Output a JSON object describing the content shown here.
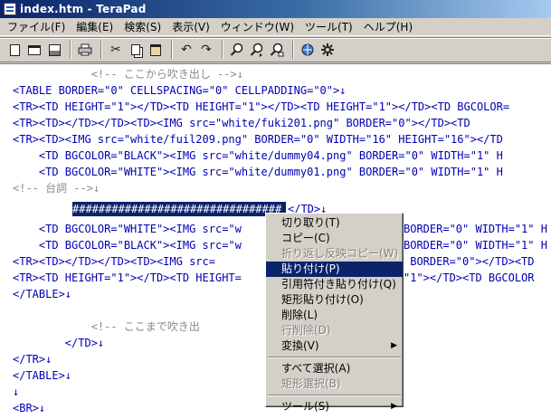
{
  "window": {
    "title": "index.htm - TeraPad"
  },
  "menubar": {
    "items": [
      {
        "label": "ファイル(F)"
      },
      {
        "label": "編集(E)"
      },
      {
        "label": "検索(S)"
      },
      {
        "label": "表示(V)"
      },
      {
        "label": "ウィンドウ(W)"
      },
      {
        "label": "ツール(T)"
      },
      {
        "label": "ヘルプ(H)"
      }
    ]
  },
  "toolbar": {
    "buttons": [
      {
        "icon": "new-file-icon"
      },
      {
        "icon": "open-file-icon"
      },
      {
        "icon": "save-icon"
      },
      {
        "icon": "print-icon"
      },
      {
        "icon": "cut-icon"
      },
      {
        "icon": "copy-icon"
      },
      {
        "icon": "paste-icon"
      },
      {
        "icon": "undo-icon"
      },
      {
        "icon": "redo-icon"
      },
      {
        "icon": "search-icon"
      },
      {
        "icon": "search-next-icon"
      },
      {
        "icon": "replace-icon"
      },
      {
        "icon": "browser-icon"
      },
      {
        "icon": "settings-icon"
      }
    ]
  },
  "editor": {
    "eol_mark": "↓",
    "lines": [
      "            <!-- ここから吹き出し -->↓",
      "<TABLE BORDER=\"0\" CELLSPACING=\"0\" CELLPADDING=\"0\">↓",
      "<TR><TD HEIGHT=\"1\"></TD><TD HEIGHT=\"1\"></TD><TD HEIGHT=\"1\"></TD><TD BGCOLOR=",
      "<TR><TD></TD></TD><TD><IMG src=\"white/fuki201.png\" BORDER=\"0\"></TD><TD",
      "<TR><TD><IMG src=\"white/fuil209.png\" BORDER=\"0\" WIDTH=\"16\" HEIGHT=\"16\"></TD",
      "    <TD BGCOLOR=\"BLACK\"><IMG src=\"white/dummy04.png\" BORDER=\"0\" WIDTH=\"1\" H",
      "    <TD BGCOLOR=\"WHITE\"><IMG src=\"white/dummy01.png\" BORDER=\"0\" WIDTH=\"1\" H",
      "<!-- 台詞 -->↓",
      "",
      "    <TD BGCOLOR=\"WHITE\"><IMG src=\"w",
      "    <TD BGCOLOR=\"BLACK\"><IMG src=\"w",
      "<TR><TD></TD></TD><TD><IMG src=",
      "<TR><TD HEIGHT=\"1\"></TD><TD HEIGHT=",
      "</TABLE>↓",
      "",
      "            <!-- ここまで吹き出",
      "        </TD>↓",
      "</TR>↓",
      "</TABLE>↓",
      "↓",
      "<BR>↓",
      "↓"
    ],
    "right_fragments": [
      "BORDER=\"0\" WIDTH=\"1\" H",
      "BORDER=\"0\" WIDTH=\"1\" H",
      " BORDER=\"0\"></TD><TD",
      "\"1\"></TD><TD BGCOLOR"
    ],
    "selected_text": "################################",
    "after_selection": "</TD>↓"
  },
  "context_menu": {
    "items": [
      {
        "label": "切り取り(T)",
        "state": "enabled"
      },
      {
        "label": "コピー(C)",
        "state": "enabled"
      },
      {
        "label": "折り返し反映コピー(W)",
        "state": "disabled"
      },
      {
        "label": "貼り付け(P)",
        "state": "highlighted"
      },
      {
        "label": "引用符付き貼り付け(Q)",
        "state": "enabled"
      },
      {
        "label": "矩形貼り付け(O)",
        "state": "enabled"
      },
      {
        "label": "削除(L)",
        "state": "enabled"
      },
      {
        "label": "行削除(D)",
        "state": "disabled"
      },
      {
        "label": "変換(V)",
        "state": "enabled",
        "submenu": true
      },
      {
        "label": "すべて選択(A)",
        "state": "enabled"
      },
      {
        "label": "矩形選択(B)",
        "state": "disabled"
      },
      {
        "label": "ツール(S)",
        "state": "enabled",
        "submenu": true
      }
    ],
    "submenu_arrow": "▶"
  },
  "colors": {
    "code_text": "#0000b4",
    "comment_text": "#8a8a8a",
    "selection_bg": "#0a246a",
    "menu_bg": "#d4d0c8"
  }
}
